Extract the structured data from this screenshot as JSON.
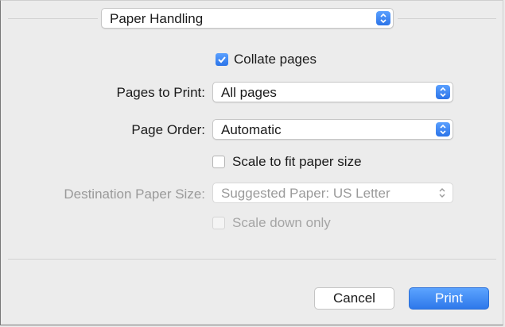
{
  "header": {
    "section_popup": "Paper Handling"
  },
  "options": {
    "collate": {
      "label": "Collate pages",
      "checked": true
    },
    "pages_to_print": {
      "label": "Pages to Print:",
      "value": "All pages"
    },
    "page_order": {
      "label": "Page Order:",
      "value": "Automatic"
    },
    "scale_to_fit": {
      "label": "Scale to fit paper size",
      "checked": false
    },
    "destination_paper_size": {
      "label": "Destination Paper Size:",
      "value": "Suggested Paper: US Letter",
      "enabled": false
    },
    "scale_down_only": {
      "label": "Scale down only",
      "checked": false,
      "enabled": false
    }
  },
  "footer": {
    "cancel_label": "Cancel",
    "print_label": "Print"
  },
  "colors": {
    "accent": "#2c74e8",
    "background": "#ececec",
    "disabled_text": "#9a9a9a"
  }
}
